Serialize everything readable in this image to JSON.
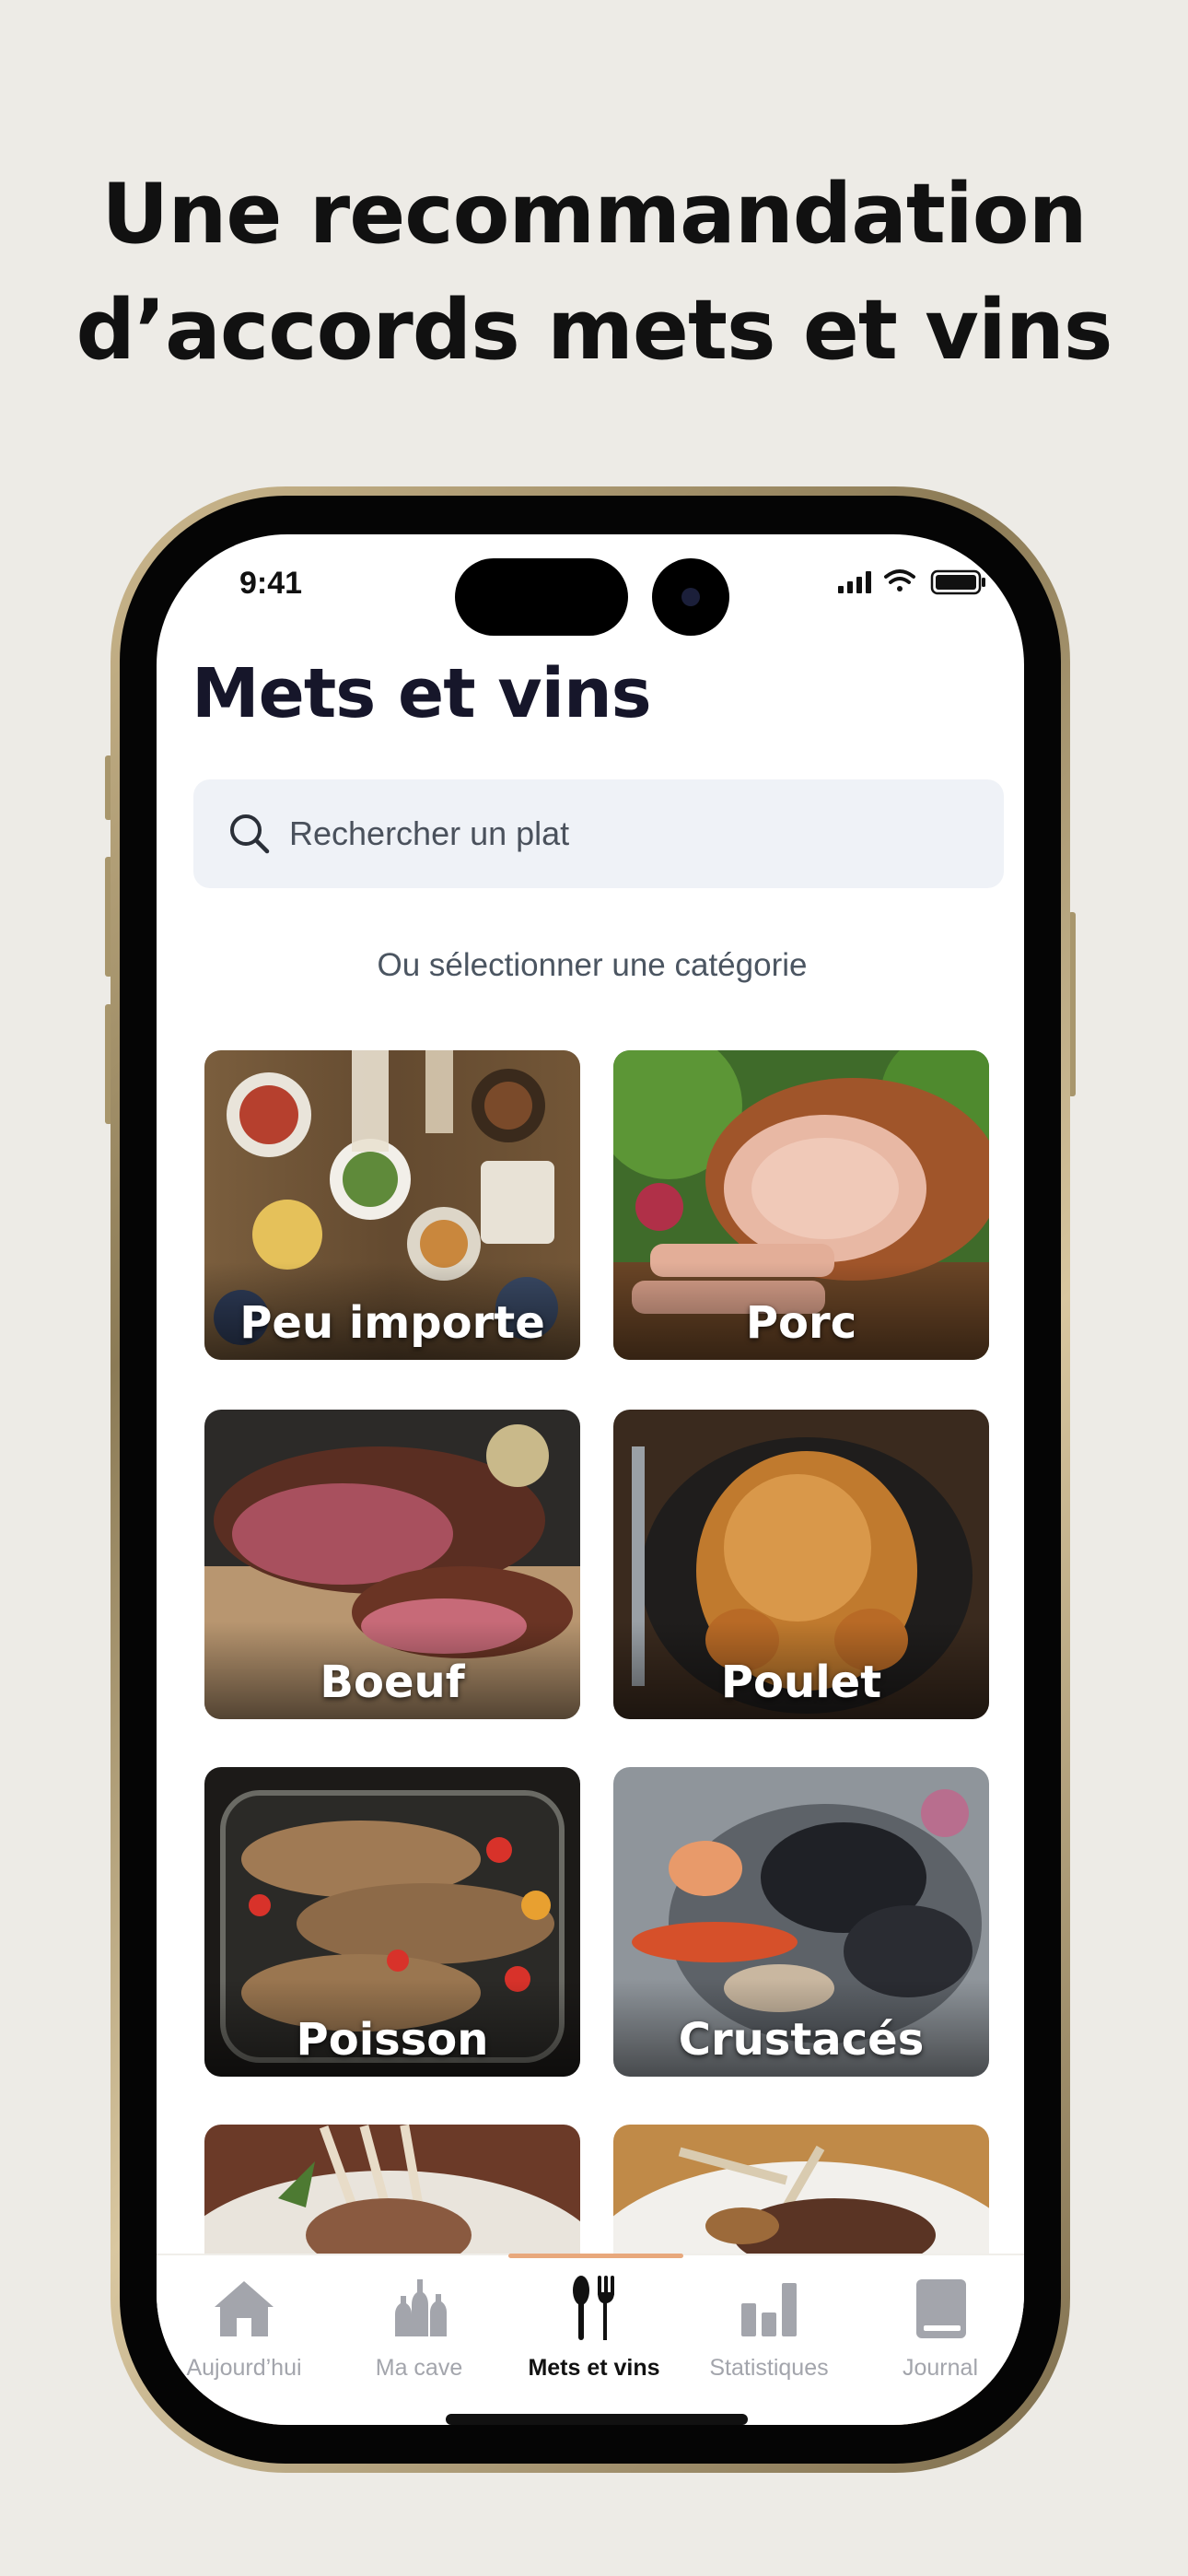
{
  "headline": {
    "line1": "Une recommandation",
    "line2": "d’accords mets et vins"
  },
  "status_bar": {
    "time": "9:41"
  },
  "page": {
    "title": "Mets et vins",
    "search_placeholder": "Rechercher un plat",
    "section_label": "Ou sélectionner une catégorie"
  },
  "categories": [
    {
      "label": "Peu importe",
      "image": "table-feast-image"
    },
    {
      "label": "Porc",
      "image": "roast-pork-image"
    },
    {
      "label": "Boeuf",
      "image": "steak-image"
    },
    {
      "label": "Poulet",
      "image": "roast-chicken-image"
    },
    {
      "label": "Poisson",
      "image": "baked-fish-image"
    },
    {
      "label": "Crustacés",
      "image": "seafood-platter-image"
    },
    {
      "label": "",
      "image": "lamb-rack-image"
    },
    {
      "label": "",
      "image": "lamb-chops-plate-image"
    }
  ],
  "tabbar": {
    "items": [
      {
        "label": "Aujourd’hui",
        "icon": "home-icon",
        "active": false
      },
      {
        "label": "Ma cave",
        "icon": "bottles-icon",
        "active": false
      },
      {
        "label": "Mets et vins",
        "icon": "fork-spoon-icon",
        "active": true
      },
      {
        "label": "Statistiques",
        "icon": "bar-chart-icon",
        "active": false
      },
      {
        "label": "Journal",
        "icon": "book-icon",
        "active": false
      }
    ]
  },
  "colors": {
    "background": "#edebe6",
    "search_bg": "#eff2f7",
    "active_tab_indicator": "#e8a87c",
    "inactive_tab": "#a3a5ac"
  }
}
